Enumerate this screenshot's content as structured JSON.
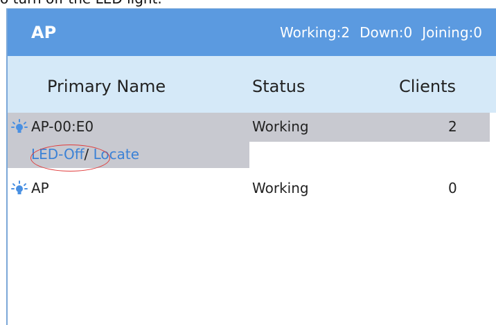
{
  "caption": "o turn off the LED light.",
  "header": {
    "title": "AP",
    "working": "Working:2",
    "down": "Down:0",
    "joining": "Joining:0"
  },
  "columns": {
    "name": "Primary Name",
    "status": "Status",
    "clients": "Clients"
  },
  "rows": [
    {
      "name": "AP-00:E0",
      "status": "Working",
      "clients": "2",
      "selected": true
    },
    {
      "name": "AP",
      "status": "Working",
      "clients": "0",
      "selected": false
    }
  ],
  "actions": {
    "led_off": "LED-Off",
    "separator": "/",
    "locate": "Locate"
  },
  "colors": {
    "header": "#5b9ae0",
    "column_header": "#d5e9f8",
    "selected_row": "#c8c9d0",
    "link": "#3b82d6",
    "highlight_ellipse": "#e03a3a",
    "bulb": "#4a90e2"
  },
  "icons": [
    "led-bulb-icon"
  ]
}
